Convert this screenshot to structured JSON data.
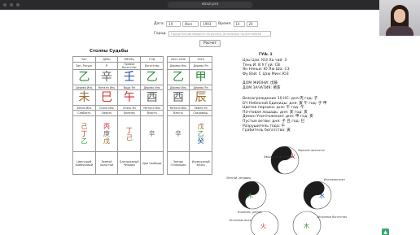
{
  "browser": {
    "url": "ebazi.pro"
  },
  "form": {
    "date_label": "Дата:",
    "day": "19",
    "month": "Июл",
    "year": "1993",
    "time_label": "Время:",
    "hour": "14",
    "minute": "20",
    "city_label": "Город:",
    "city_placeholder": "Город России вводите по-русски, остальные по-английски",
    "calc_button": "Расчет"
  },
  "pillars": {
    "title": "Столпы Судьбы",
    "headers": [
      "ЧАС",
      "ДЕНЬ",
      "МЕСЯЦ",
      "ГОД"
    ],
    "luck_headers": [
      "2021-2030",
      "2024"
    ],
    "top_gods": [
      "Зап. Ресурс",
      "Я",
      "Прямое богатство",
      "Богатство"
    ],
    "top_gods_luck": [
      "Дерево Инь",
      "Дерево Ян"
    ],
    "stems": [
      "乙",
      "辛",
      "壬",
      "乙",
      "乙",
      "甲"
    ],
    "stem_labels": [
      "Дерево Инь",
      "Металл Инь",
      "Вода Ян",
      "Дерево Инь",
      "Дерево Инь",
      "Дерево Ян"
    ],
    "branches": [
      "未",
      "巳",
      "午",
      "酉",
      "酉",
      "辰"
    ],
    "branch_labels": [
      "Земля Инь",
      "Огонь Инь",
      "Огонь Ян",
      "Металл Инь",
      "Металл Инь",
      "Земля Ян"
    ],
    "stages": [
      "Слабость",
      "Смерть",
      "Болезнь",
      "Власть",
      "Власть",
      "Сокровищ."
    ],
    "hidden": [
      [
        "己",
        "丁",
        "乙"
      ],
      [
        "丙",
        "庚",
        "戊"
      ],
      [
        "丁",
        "己"
      ],
      [
        "辛"
      ],
      [
        "辛"
      ],
      [
        "戊",
        "乙",
        "癸"
      ]
    ],
    "stars": [
      "Цветущий Бамбуковый",
      "Земной Холостой",
      "Благородный Человек",
      "Дом Свободы",
      "Звезда Генерации",
      "Изумрудный вечер"
    ]
  },
  "gua": {
    "title": "ГУА: 1",
    "rows": [
      "Цзы Цзи: Ю3       Ха чай: 3",
      "Тянь И: В         У Гуй: СВ",
      "Ян Няньи: Ю       Лю Ша: С3",
      "Фу Вэй: С         Цзю Мин: Ю3"
    ],
    "home_life": "ДОМ ЖИЗНИ: 戊辰",
    "home_conception": "ДОМ ЗАЧАТИЯ: 癸亥",
    "lines": [
      "Вознаграждение 10 НС: дня 丙 год: 子",
      "БЧ Небесной Единицы: дня: 寅 午 год: 子 申",
      "Цветок персика: дня: 午 год: 午",
      "Почтовая лошадь: дня: 亥 год: 亥",
      "Демон Уничтожения: дня: 申 год: 亥",
      "Пустые ветви: дня: 子 丑 год: 巳",
      "Разрушитель года: 午",
      "Грабитель богатства: 寅"
    ]
  },
  "cycle_diagram": {
    "labels": [
      "Защитник богатства",
      "Зеркало личности",
      "Лентяй, ленивец",
      "Кошелек, ресурс",
      "Истинная воля",
      "Истинное богатство",
      "Интеллектуал"
    ],
    "elements": [
      "木",
      "火",
      "土",
      "金",
      "水"
    ],
    "colors": {
      "wood": "#2e8b3e",
      "fire": "#d12c2c",
      "earth": "#9c6b2f",
      "metal": "#666666",
      "water": "#1f4fa0"
    }
  }
}
